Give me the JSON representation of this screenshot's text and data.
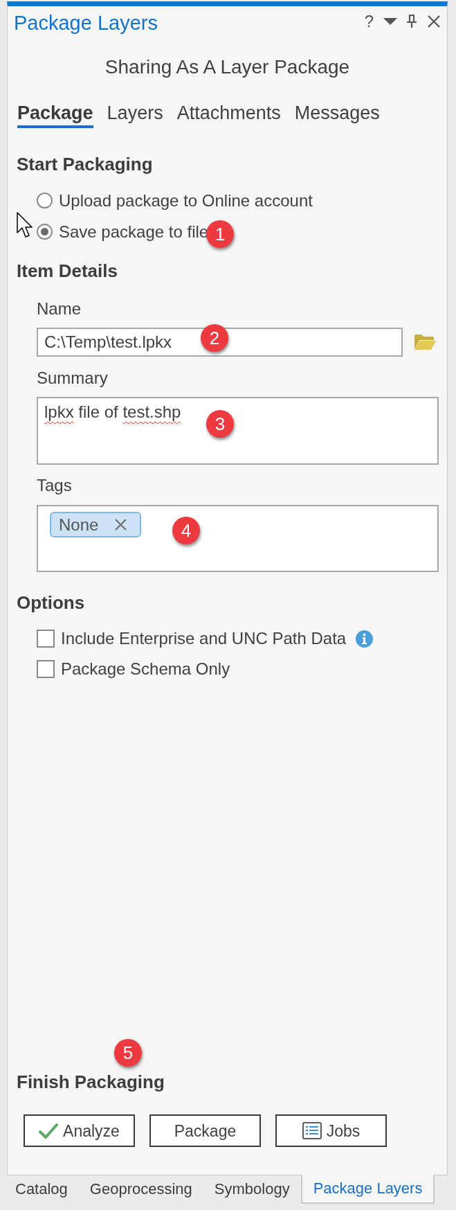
{
  "window": {
    "title": "Package Layers",
    "help_button": "?"
  },
  "subtitle": "Sharing As A Layer Package",
  "tabs": [
    {
      "label": "Package",
      "selected": true
    },
    {
      "label": "Layers",
      "selected": false
    },
    {
      "label": "Attachments",
      "selected": false
    },
    {
      "label": "Messages",
      "selected": false
    }
  ],
  "start_packaging": {
    "heading": "Start Packaging",
    "options": [
      {
        "label": "Upload package to Online account",
        "selected": false
      },
      {
        "label": "Save package to file",
        "selected": true,
        "marker": "1"
      }
    ]
  },
  "item_details": {
    "heading": "Item Details",
    "name": {
      "label": "Name",
      "value": "C:\\Temp\\test.lpkx",
      "marker": "2"
    },
    "summary": {
      "label": "Summary",
      "value": [
        {
          "text": "lpkx",
          "misspelled": true
        },
        {
          "text": " file of ",
          "misspelled": false
        },
        {
          "text": "test.shp",
          "misspelled": true
        }
      ],
      "marker": "3"
    },
    "tags": {
      "label": "Tags",
      "items": [
        "None"
      ],
      "marker": "4"
    }
  },
  "options": {
    "heading": "Options",
    "items": [
      {
        "label": "Include Enterprise and UNC Path Data",
        "checked": false,
        "info": true
      },
      {
        "label": "Package Schema Only",
        "checked": false,
        "info": false
      }
    ]
  },
  "finish_packaging": {
    "heading": "Finish Packaging",
    "marker": "5",
    "buttons": [
      {
        "label": "Analyze",
        "kind": "check"
      },
      {
        "label": "Package",
        "kind": "plain"
      },
      {
        "label": "Jobs",
        "kind": "list"
      }
    ]
  },
  "dock_tabs": [
    {
      "label": "Catalog",
      "selected": false
    },
    {
      "label": "Geoprocessing",
      "selected": false
    },
    {
      "label": "Symbology",
      "selected": false
    },
    {
      "label": "Package Layers",
      "selected": true
    }
  ]
}
